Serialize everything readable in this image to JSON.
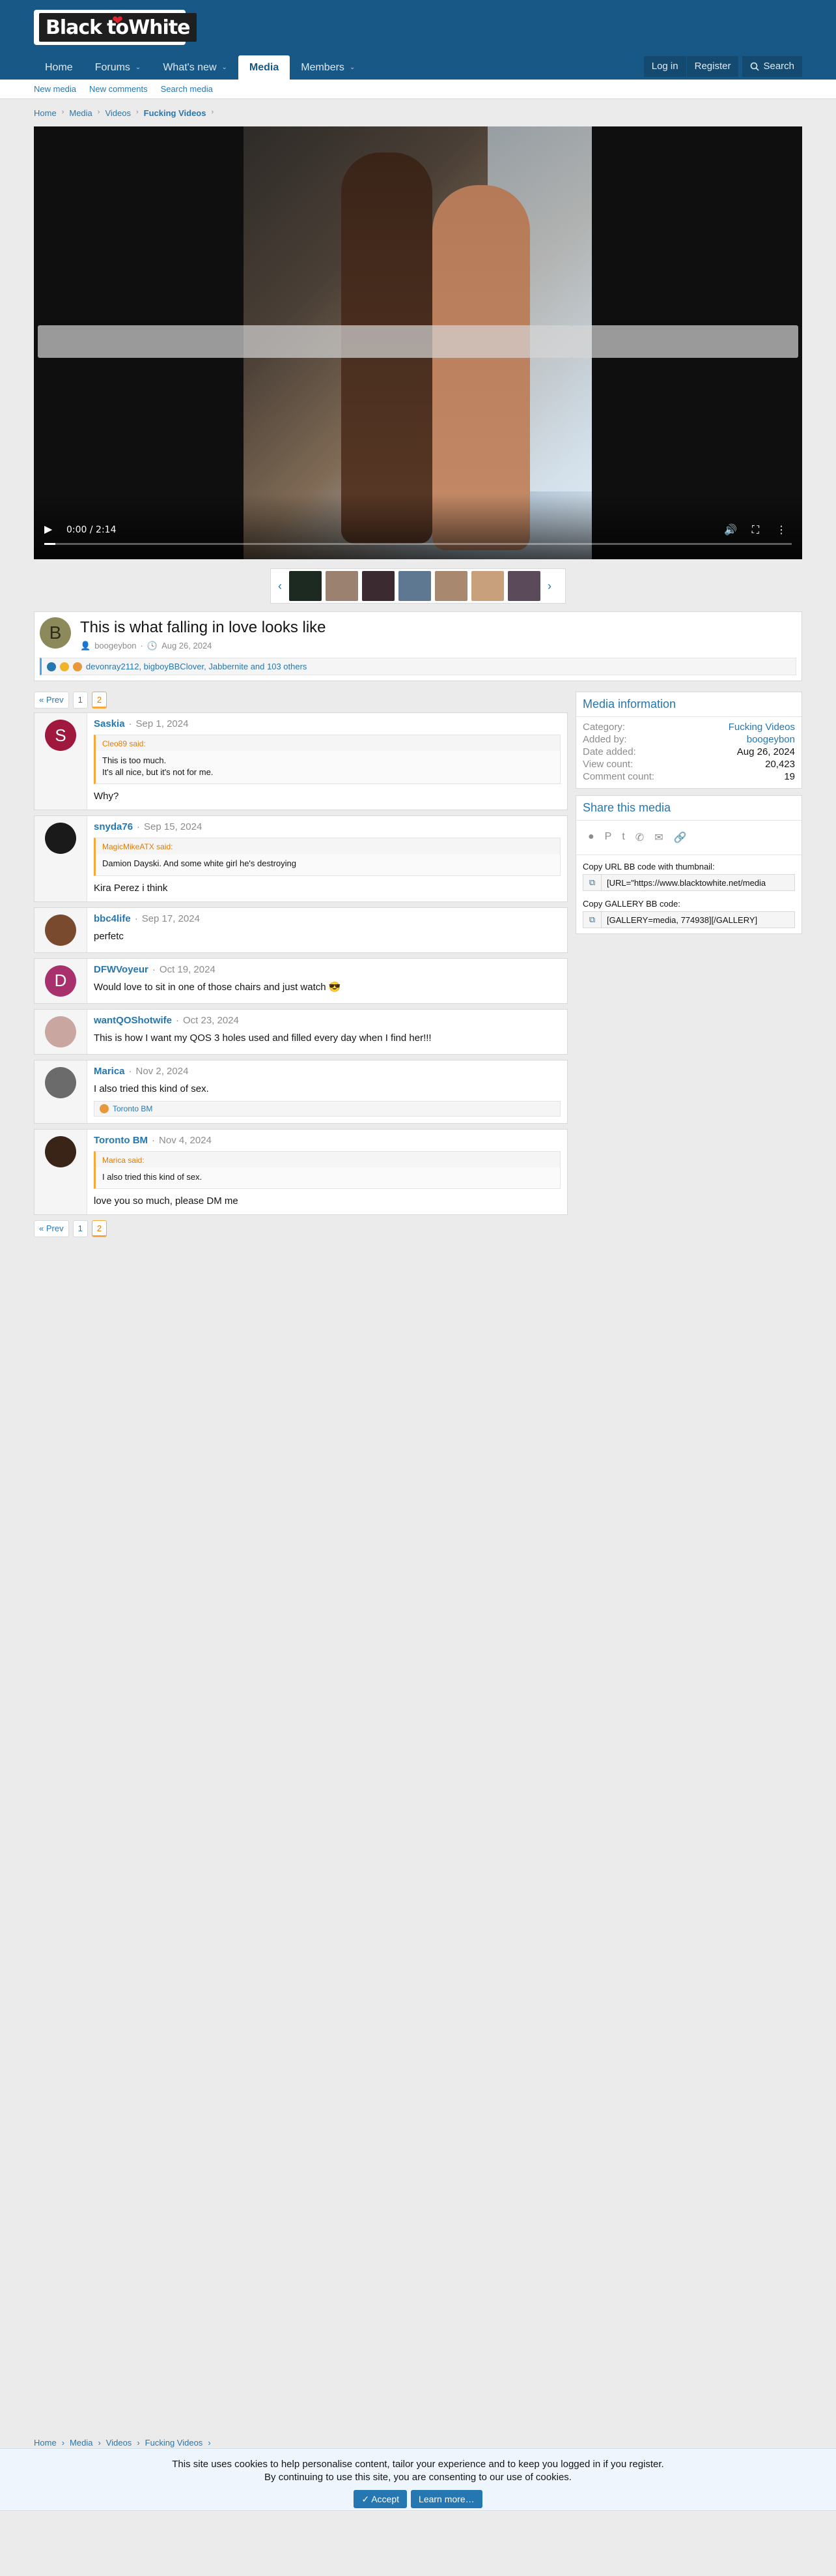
{
  "header": {
    "logo_black": "Black",
    "logo_to": "to",
    "logo_white": "White",
    "nav": [
      {
        "label": "Home",
        "has_menu": false
      },
      {
        "label": "Forums",
        "has_menu": true
      },
      {
        "label": "What's new",
        "has_menu": true
      },
      {
        "label": "Media",
        "has_menu": false,
        "active": true
      },
      {
        "label": "Members",
        "has_menu": true
      }
    ],
    "login": "Log in",
    "register": "Register",
    "search": "Search"
  },
  "subnav": [
    "New media",
    "New comments",
    "Search media"
  ],
  "breadcrumb": [
    "Home",
    "Media",
    "Videos",
    "Fucking Videos"
  ],
  "video": {
    "time": "0:00 / 2:14",
    "progress_fraction": 0.015
  },
  "media": {
    "avatar_letter": "B",
    "title": "This is what falling in love looks like",
    "author": "boogeybon",
    "date": "Aug 26, 2024",
    "reactions": "devonray2112, bigboyBBClover, Jabbernite and 103 others"
  },
  "pager": {
    "prev": "« Prev",
    "pages": [
      "1",
      "2"
    ],
    "current": "2"
  },
  "comments": [
    {
      "name": "Saskia",
      "date": "Sep 1, 2024",
      "avatar_letter": "S",
      "avatar_color": "#a0183d",
      "quote_author": "Cleo89 said:",
      "quote_lines": [
        "This is too much.",
        "It's all nice, but it's not for me."
      ],
      "text": "Why?",
      "reaction": ""
    },
    {
      "name": "snyda76",
      "date": "Sep 15, 2024",
      "avatar_letter": "",
      "avatar_color": "#1a1a1a",
      "quote_author": "MagicMikeATX said:",
      "quote_lines": [
        "Damion Dayski. And some white girl he's destroying"
      ],
      "text": "Kira Perez i think",
      "reaction": ""
    },
    {
      "name": "bbc4life",
      "date": "Sep 17, 2024",
      "avatar_letter": "",
      "avatar_color": "#7a4a2e",
      "quote_author": "",
      "quote_lines": [],
      "text": "perfetc",
      "reaction": ""
    },
    {
      "name": "DFWVoyeur",
      "date": "Oct 19, 2024",
      "avatar_letter": "D",
      "avatar_color": "#a8306d",
      "quote_author": "",
      "quote_lines": [],
      "text": "Would love to sit in one of those chairs and just watch 😎",
      "reaction": ""
    },
    {
      "name": "wantQOShotwife",
      "date": "Oct 23, 2024",
      "avatar_letter": "",
      "avatar_color": "#c9a6a0",
      "quote_author": "",
      "quote_lines": [],
      "text": "This is how I want my QOS 3 holes used and filled every day when I find her!!!",
      "reaction": ""
    },
    {
      "name": "Marica",
      "date": "Nov 2, 2024",
      "avatar_letter": "",
      "avatar_color": "#6b6b6b",
      "quote_author": "",
      "quote_lines": [],
      "text": "I also tried this kind of sex.",
      "reaction": "Toronto BM"
    },
    {
      "name": "Toronto BM",
      "date": "Nov 4, 2024",
      "avatar_letter": "",
      "avatar_color": "#3a2418",
      "quote_author": "Marica said:",
      "quote_lines": [
        "I also tried this kind of sex."
      ],
      "text": "love you so much, please DM me",
      "reaction": ""
    }
  ],
  "info": {
    "title": "Media information",
    "rows": [
      {
        "k": "Category:",
        "v": "Fucking Videos",
        "link": true
      },
      {
        "k": "Added by:",
        "v": "boogeybon",
        "link": true
      },
      {
        "k": "Date added:",
        "v": "Aug 26, 2024",
        "link": false
      },
      {
        "k": "View count:",
        "v": "20,423",
        "link": false
      },
      {
        "k": "Comment count:",
        "v": "19",
        "link": false
      }
    ]
  },
  "share": {
    "title": "Share this media",
    "url_label": "Copy URL BB code with thumbnail:",
    "url_value": "[URL=\"https://www.blacktowhite.net/media",
    "gallery_label": "Copy GALLERY BB code:",
    "gallery_value": "[GALLERY=media, 774938][/GALLERY]"
  },
  "cookie": {
    "line1": "This site uses cookies to help personalise content, tailor your experience and to keep you logged in if you register.",
    "line2": "By continuing to use this site, you are consenting to our use of cookies.",
    "accept": "Accept",
    "learn": "Learn more…"
  },
  "colors": {
    "header": "#185886",
    "link": "#2577b1",
    "accent": "#f7a839"
  }
}
